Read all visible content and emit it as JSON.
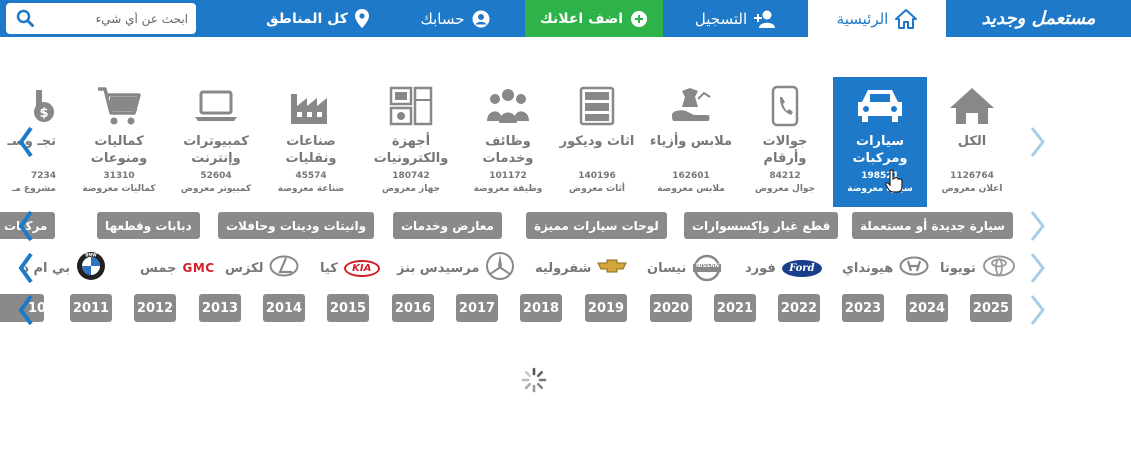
{
  "header": {
    "logo_text": "مستعمل وجديد",
    "home_label": "الرئيسية",
    "register_label": "التسجيل",
    "add_ad_label": "اضف اعلانك",
    "account_label": "حسابك",
    "areas_label": "كل المناطق",
    "search_placeholder": "ابحث عن أي شيء",
    "colors": {
      "brand": "#1e7ac8",
      "add": "#2db34a"
    }
  },
  "categories": [
    {
      "name": "الكل",
      "count": "1126764",
      "unit": "اعلان معروض",
      "icon": "home-icon"
    },
    {
      "name": "سيارات ومركبات",
      "count": "198521",
      "unit": "سيارة معروضة",
      "icon": "car-icon"
    },
    {
      "name": "جوالات وأرقام",
      "count": "84212",
      "unit": "جوال معروض",
      "icon": "phone-icon"
    },
    {
      "name": "ملابس وأزياء",
      "count": "162601",
      "unit": "ملابس معروضة",
      "icon": "clothes-icon"
    },
    {
      "name": "اثاث وديكور",
      "count": "140196",
      "unit": "أثاث معروض",
      "icon": "furniture-icon"
    },
    {
      "name": "وظائف وخدمات",
      "count": "101172",
      "unit": "وظيفة معروضة",
      "icon": "people-icon"
    },
    {
      "name": "أجهزة والكترونيات",
      "count": "180742",
      "unit": "جهاز معروض",
      "icon": "appliances-icon"
    },
    {
      "name": "صناعات ونقليات",
      "count": "45574",
      "unit": "صناعة معروضة",
      "icon": "factory-icon"
    },
    {
      "name": "كمبيوترات وإنترنت",
      "count": "52604",
      "unit": "كمبيوتر معروض",
      "icon": "laptop-icon"
    },
    {
      "name": "كماليات ومنوعات",
      "count": "31310",
      "unit": "كماليات معروضة",
      "icon": "cart-icon"
    },
    {
      "name": "تجـ وسـ",
      "count": "7234",
      "unit": "مشروع مـ",
      "icon": "money-icon"
    }
  ],
  "subcategories": [
    "سيارة جديدة أو مستعملة",
    "قطع غيار وإكسسوارات",
    "لوحات سيارات مميزة",
    "معارض وخدمات",
    "وانيتات ودينات وحافلات",
    "دبابات وقطعها",
    "مركبات"
  ],
  "brands": [
    {
      "name": "تويوتا",
      "logo": "toyota-logo"
    },
    {
      "name": "هيونداي",
      "logo": "hyundai-logo"
    },
    {
      "name": "فورد",
      "logo": "ford-logo",
      "badge": "Ford"
    },
    {
      "name": "نيسان",
      "logo": "nissan-logo",
      "badge": "NISSAN"
    },
    {
      "name": "شفروليه",
      "logo": "chevrolet-logo"
    },
    {
      "name": "مرسيدس بنز",
      "logo": "mercedes-logo"
    },
    {
      "name": "كيا",
      "logo": "kia-logo",
      "badge": "KIA"
    },
    {
      "name": "لكزس",
      "logo": "lexus-logo"
    },
    {
      "name": "جمس",
      "logo": "gmc-logo",
      "badge": "GMC"
    },
    {
      "name": "بي ام د",
      "logo": "bmw-logo",
      "badge": "BMW"
    }
  ],
  "years": [
    "2025",
    "2024",
    "2023",
    "2022",
    "2021",
    "2020",
    "2019",
    "2018",
    "2017",
    "2016",
    "2015",
    "2014",
    "2013",
    "2012",
    "2011",
    "10"
  ]
}
